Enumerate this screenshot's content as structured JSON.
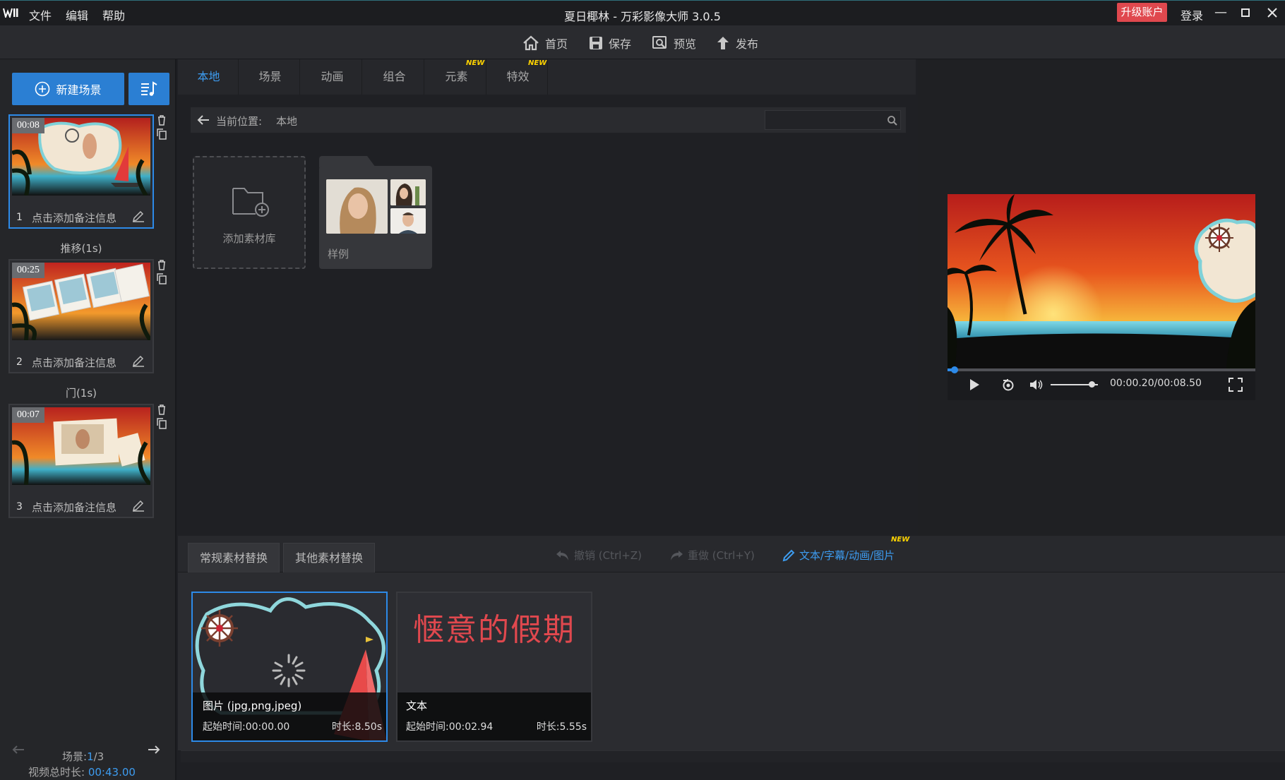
{
  "titlebar": {
    "menu": [
      "文件",
      "编辑",
      "帮助"
    ],
    "title": "夏日椰林 - 万彩影像大师 3.0.5",
    "upgrade": "升级账户",
    "login": "登录"
  },
  "toolbar": {
    "home": "首页",
    "save": "保存",
    "preview": "预览",
    "publish": "发布"
  },
  "left": {
    "new_scene": "新建场景",
    "scenes": [
      {
        "time": "00:08",
        "num": "1",
        "note": "点击添加备注信息"
      },
      {
        "time": "00:25",
        "num": "2",
        "note": "点击添加备注信息"
      },
      {
        "time": "00:07",
        "num": "3",
        "note": "点击添加备注信息"
      }
    ],
    "transitions": [
      "推移(1s)",
      "门(1s)"
    ],
    "scene_label": "场景:",
    "scene_current": "1",
    "scene_total": "/3",
    "total_label": "视频总时长:",
    "total_value": "00:43.00"
  },
  "tabs": [
    {
      "label": "本地",
      "new": false
    },
    {
      "label": "场景",
      "new": false
    },
    {
      "label": "动画",
      "new": false
    },
    {
      "label": "组合",
      "new": false
    },
    {
      "label": "元素",
      "new": true
    },
    {
      "label": "特效",
      "new": true
    }
  ],
  "new_badge": "NEW",
  "location": {
    "label": "当前位置:",
    "value": "本地",
    "search_placeholder": ""
  },
  "library": {
    "add": "添加素材库",
    "sample": "样例"
  },
  "player": {
    "time": "00:00.20/00:08.50",
    "progress": 0.024,
    "volume": 0.8
  },
  "bottom": {
    "tabs": [
      "常规素材替换",
      "其他素材替换"
    ],
    "undo": "撤销 (Ctrl+Z)",
    "redo": "重做 (Ctrl+Y)",
    "text_edit": "文本/字幕/动画/图片",
    "cards": [
      {
        "type": "图片 (jpg,png,jpeg)",
        "start": "起始时间:00:00.00",
        "duration": "时长:8.50s"
      },
      {
        "type": "文本",
        "start": "起始时间:00:02.94",
        "duration": "时长:5.55s",
        "preview_text": "惬意的假期"
      }
    ]
  },
  "colors": {
    "accent": "#2b7fd3",
    "active_tab": "#3d9cf0",
    "upgrade": "#e0484e",
    "text_red": "#e0484e"
  }
}
